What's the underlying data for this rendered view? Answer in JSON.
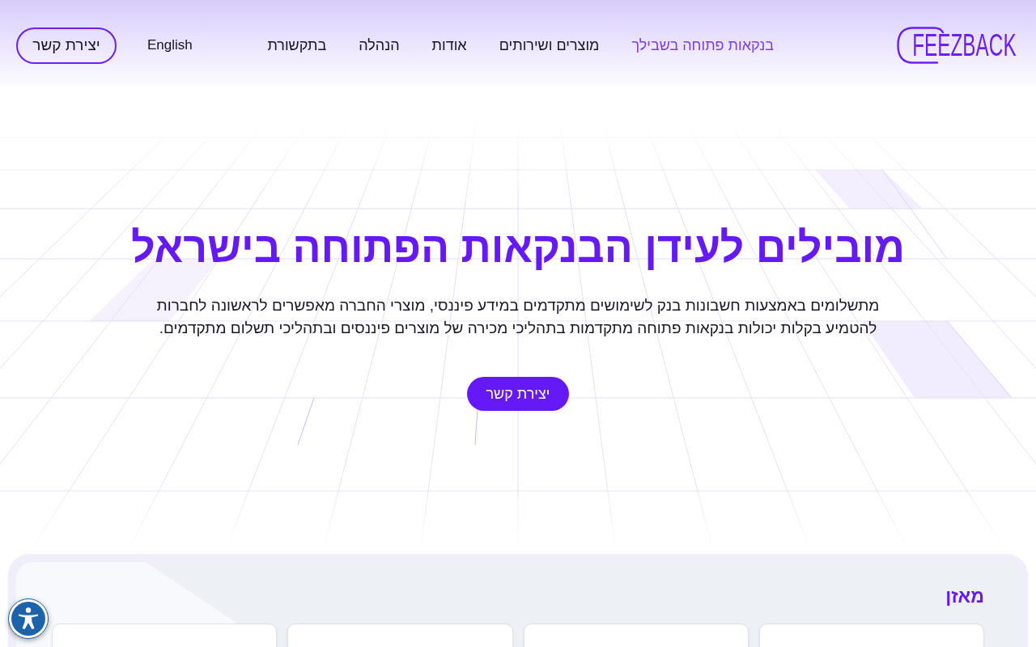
{
  "header": {
    "logo": "FEEZBACK",
    "nav": [
      {
        "label": "בנקאות פתוחה בשבילך",
        "selected": true
      },
      {
        "label": "מוצרים ושירותים",
        "selected": false
      },
      {
        "label": "אודות",
        "selected": false
      },
      {
        "label": "הנהלה",
        "selected": false
      },
      {
        "label": "בתקשורת",
        "selected": false
      }
    ],
    "language_link": "English",
    "contact_button": "יצירת קשר"
  },
  "hero": {
    "title": "מובילים לעידן הבנקאות הפתוחה בישראל",
    "description": "מתשלומים באמצעות חשבונות בנק לשימושים מתקדמים במידע פיננסי, מוצרי החברה מאפשרים לראשונה לחברות להטמיע בקלות יכולות בנקאות פתוחה מתקדמות בתהליכי מכירה של מוצרים פיננסים ובתהליכי תשלום מתקדמים.",
    "button": "יצירת קשר"
  },
  "section": {
    "title": "מאזן"
  }
}
